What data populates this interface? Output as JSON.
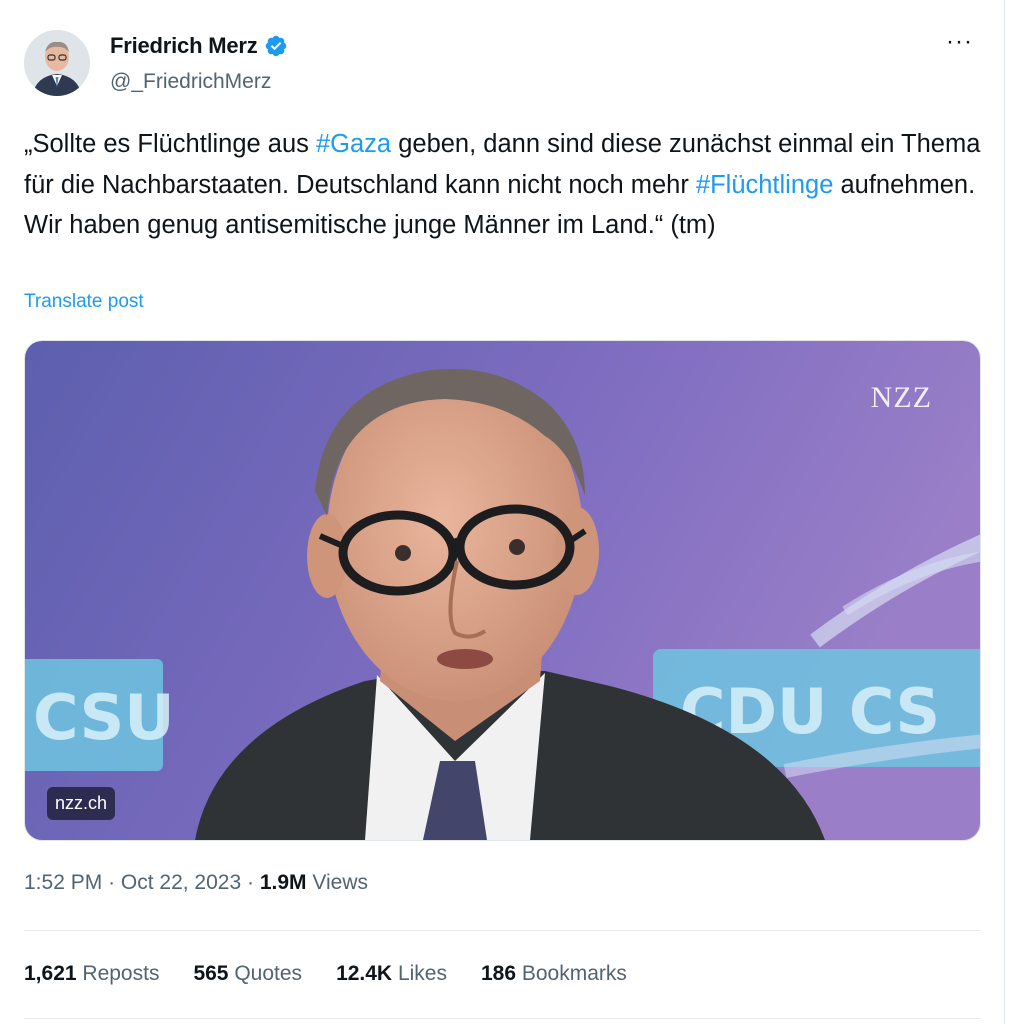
{
  "author": {
    "name": "Friedrich Merz",
    "handle": "@_FriedrichMerz",
    "verified": true
  },
  "tweet": {
    "text_segments": [
      "„Sollte es Flüchtlinge aus ",
      "#Gaza",
      " geben, dann sind diese zunächst einmal ein Thema für die Nachbarstaaten. Deutschland kann nicht noch mehr ",
      "#Flüchtlinge",
      " aufnehmen. Wir haben genug antisemitische junge Männer im Land.“ (tm)"
    ],
    "translate_label": "Translate post"
  },
  "media": {
    "watermark": "NZZ",
    "link_domain": "nzz.ch",
    "backdrop_text_left": "CSU",
    "backdrop_text_right": "CDU CS"
  },
  "meta": {
    "time": "1:52 PM",
    "separator": "·",
    "date": "Oct 22, 2023",
    "views_count": "1.9M",
    "views_label": "Views"
  },
  "stats": [
    {
      "count": "1,621",
      "label": "Reposts"
    },
    {
      "count": "565",
      "label": "Quotes"
    },
    {
      "count": "12.4K",
      "label": "Likes"
    },
    {
      "count": "186",
      "label": "Bookmarks"
    }
  ],
  "colors": {
    "accent": "#1d9bf0",
    "text": "#0f1419",
    "secondary": "#536471"
  },
  "icons": {
    "verified": "verified-badge-icon",
    "more": "more-options-icon"
  }
}
